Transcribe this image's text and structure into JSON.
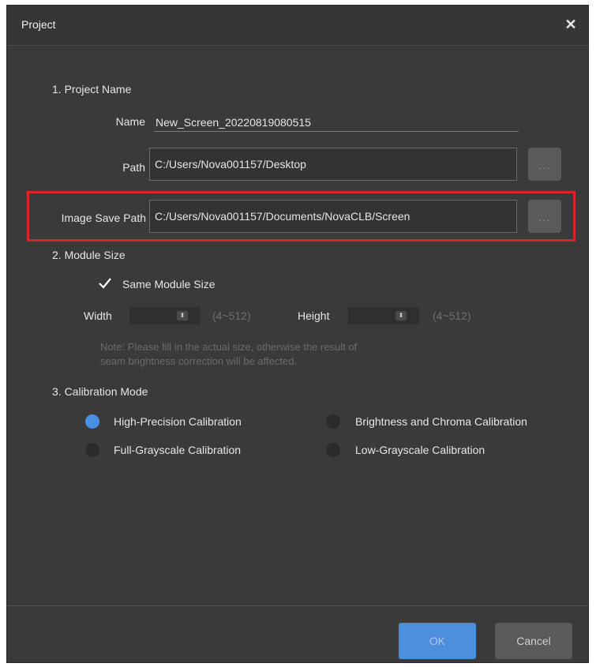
{
  "dialog": {
    "title": "Project",
    "close_icon": "close-icon"
  },
  "section1": {
    "heading": "1. Project Name",
    "name_label": "Name",
    "name_value": "New_Screen_20220819080515",
    "path_label": "Path",
    "path_value": "C:/Users/Nova001157/Desktop",
    "browse_label": "...",
    "image_save_label": "Image Save Path",
    "image_save_value": "C:/Users/Nova001157/Documents/NovaCLB/Screen",
    "image_browse_label": "..."
  },
  "section2": {
    "heading": "2. Module Size",
    "same_module_label": "Same Module Size",
    "same_module_checked": true,
    "width_label": "Width",
    "width_range": "(4~512)",
    "height_label": "Height",
    "height_range": "(4~512)",
    "note_line1": "Note: Please fill in the actual size, otherwise the result of",
    "note_line2": "seam brightness correction will be affected."
  },
  "section3": {
    "heading": "3. Calibration Mode",
    "options": [
      {
        "label": "High-Precision Calibration",
        "checked": true
      },
      {
        "label": "Brightness and Chroma Calibration",
        "checked": false
      },
      {
        "label": "Full-Grayscale Calibration",
        "checked": false
      },
      {
        "label": "Low-Grayscale Calibration",
        "checked": false
      }
    ]
  },
  "footer": {
    "ok_label": "OK",
    "cancel_label": "Cancel"
  },
  "colors": {
    "highlight": "#d8242b",
    "accent": "#4e8fdc",
    "background": "#3a3a3a"
  }
}
